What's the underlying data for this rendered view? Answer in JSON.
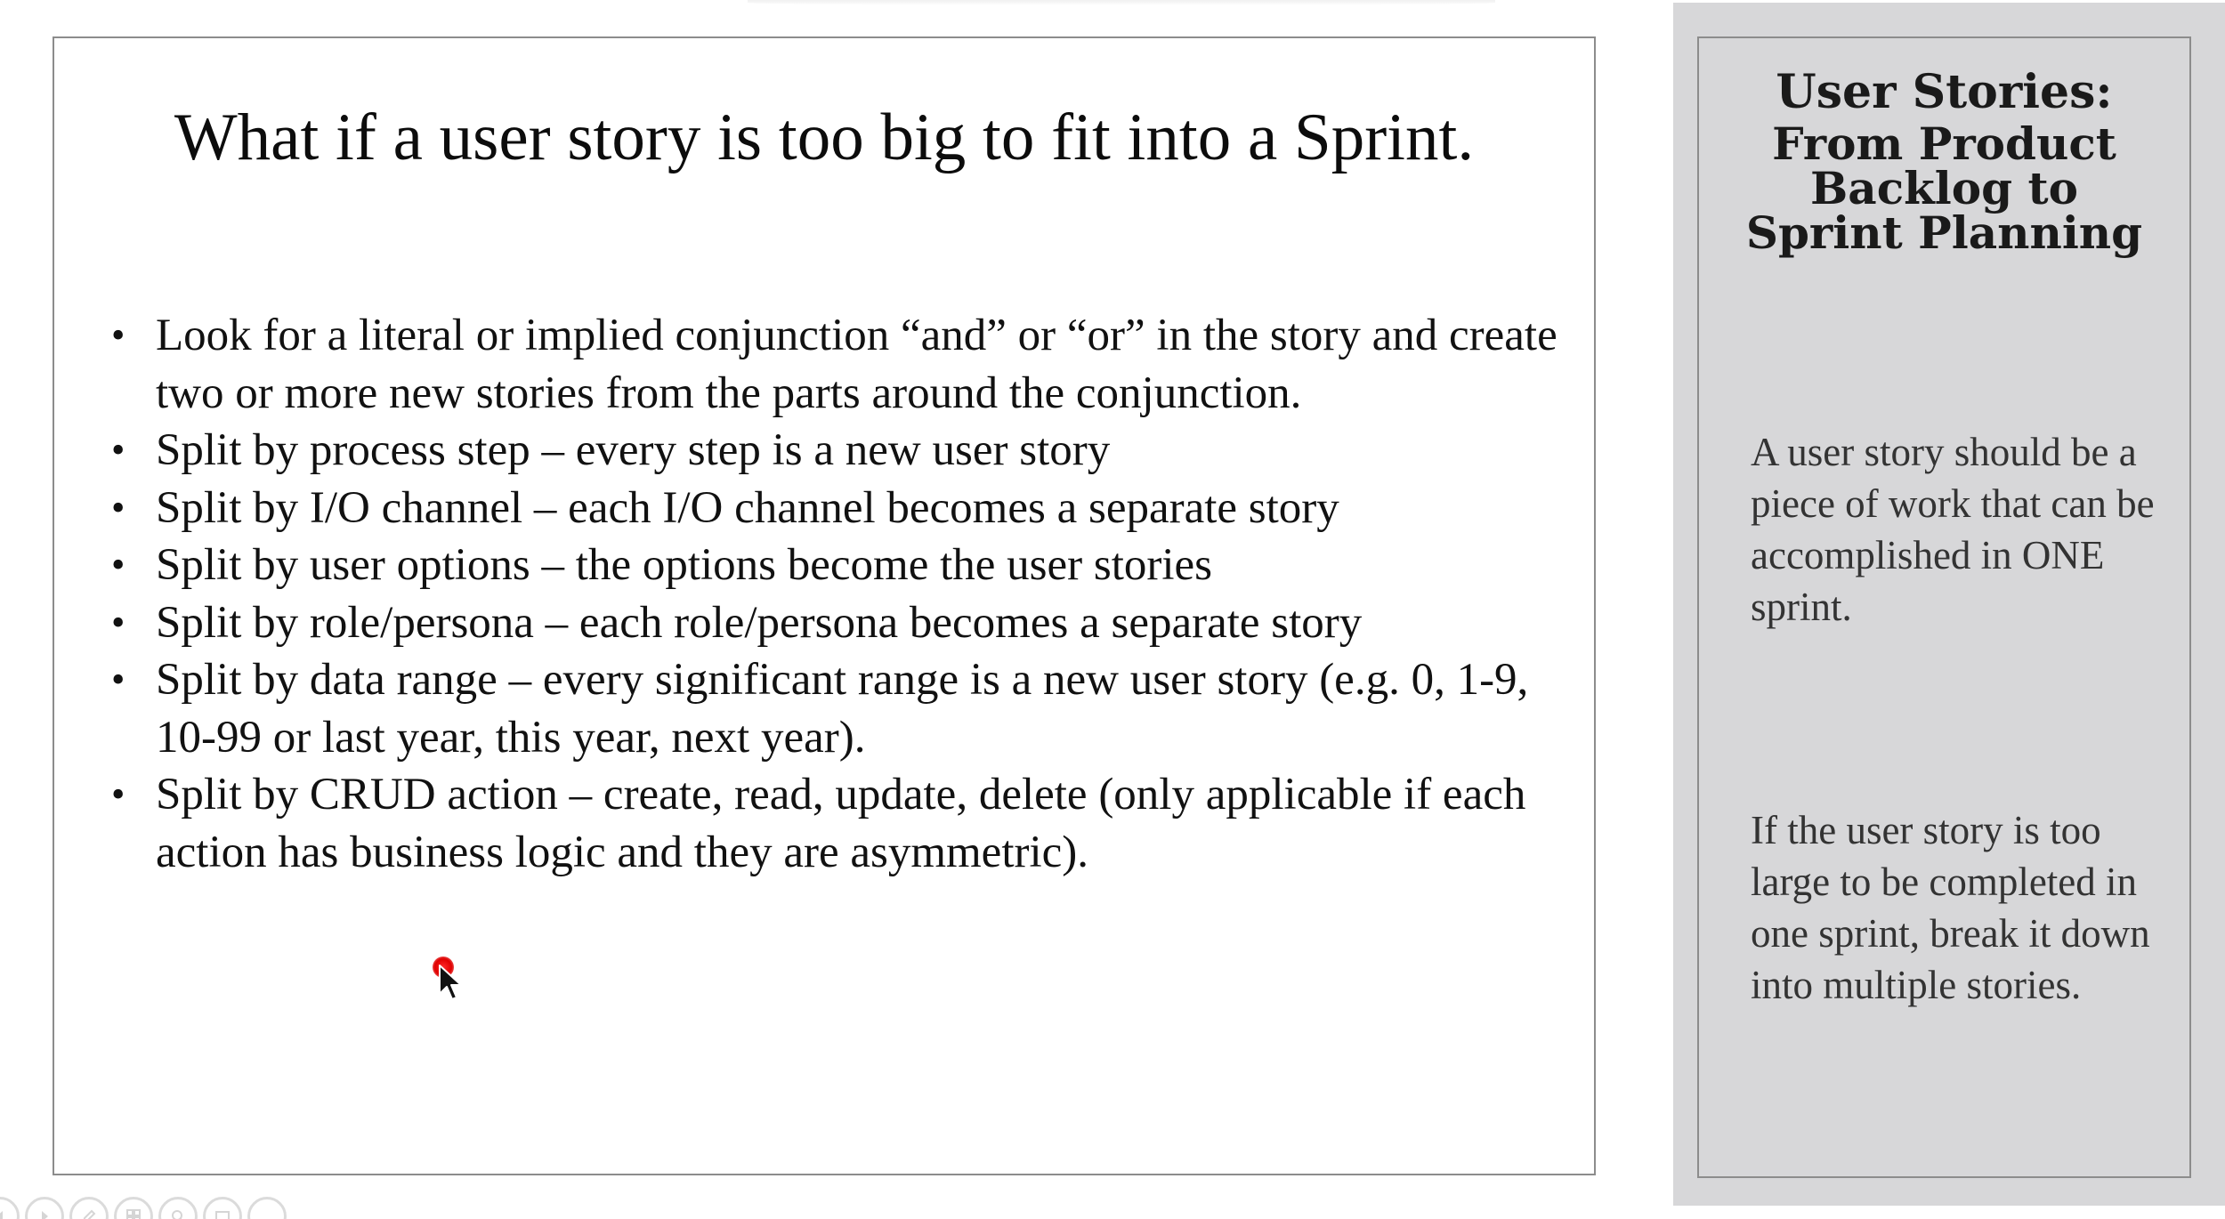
{
  "slide": {
    "title": "What if a user story is too big to fit into a Sprint.",
    "bullet_symbol": "•",
    "bullets": [
      "Look for a literal or implied conjunction “and” or “or” in the story and create two or more new stories from the parts around the conjunction.",
      "Split by process step – every step is a new user story",
      "Split by I/O channel – each I/O channel becomes a separate story",
      "Split by user options – the options become the user stories",
      "Split by role/persona – each role/persona becomes a separate story",
      "Split by data range – every significant range is a new user story (e.g. 0, 1-9, 10-99 or last year, this year, next year).",
      "Split by CRUD action – create, read, update, delete (only applicable if each action has business logic and they are asymmetric)."
    ]
  },
  "side_panel": {
    "title_line1": "User Stories:",
    "title_line2": "From Product Backlog to Sprint Planning",
    "text1": "A user story should be a piece of work that can be accomplished in ONE sprint.",
    "text2": "If the user story is too large to be completed in one sprint, break it down into multiple stories."
  },
  "toolbar": {
    "icons": [
      "previous-icon",
      "next-icon",
      "pen-icon",
      "slides-grid-icon",
      "zoom-icon",
      "subtitles-icon",
      "more-options-icon"
    ],
    "more_label": "…"
  },
  "colors": {
    "side_background": "#d7d7d9",
    "frame_border": "#8c8c8c",
    "laser": "#e00000"
  }
}
